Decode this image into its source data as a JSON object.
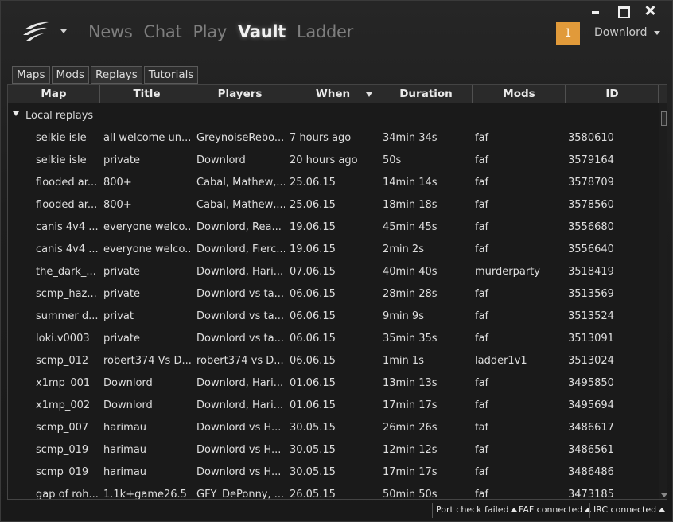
{
  "nav": {
    "items": [
      {
        "label": "News",
        "active": false
      },
      {
        "label": "Chat",
        "active": false
      },
      {
        "label": "Play",
        "active": false
      },
      {
        "label": "Vault",
        "active": true
      },
      {
        "label": "Ladder",
        "active": false
      }
    ]
  },
  "user": {
    "notification_count": "1",
    "name": "Downlord"
  },
  "tabs": [
    "Maps",
    "Mods",
    "Replays",
    "Tutorials"
  ],
  "table": {
    "columns": [
      "Map",
      "Title",
      "Players",
      "When",
      "Duration",
      "Mods",
      "ID"
    ],
    "sorted_column": "When",
    "group_label": "Local replays",
    "rows": [
      [
        "selkie isle",
        "all welcome un...",
        "GreynoiseRebo...",
        "7 hours ago",
        "34min 34s",
        "faf",
        "3580610"
      ],
      [
        "selkie isle",
        "private",
        "Downlord",
        "20 hours ago",
        "50s",
        "faf",
        "3579164"
      ],
      [
        "flooded ar...",
        "800+",
        "Cabal, Mathew,...",
        "25.06.15",
        "14min 14s",
        "faf",
        "3578709"
      ],
      [
        "flooded ar...",
        "800+",
        "Cabal, Mathew,...",
        "25.06.15",
        "18min 18s",
        "faf",
        "3578560"
      ],
      [
        "canis 4v4 ...",
        "everyone welco...",
        "Downlord, Rea...",
        "19.06.15",
        "45min 45s",
        "faf",
        "3556680"
      ],
      [
        "canis 4v4 ...",
        "everyone welco...",
        "Downlord, Fierc...",
        "19.06.15",
        "2min 2s",
        "faf",
        "3556640"
      ],
      [
        "the_dark_...",
        "private",
        "Downlord, Hari...",
        "07.06.15",
        "40min 40s",
        "murderparty",
        "3518419"
      ],
      [
        "scmp_haz...",
        "private",
        "Downlord vs ta...",
        "06.06.15",
        "28min 28s",
        "faf",
        "3513569"
      ],
      [
        "summer d...",
        "privat",
        "Downlord vs ta...",
        "06.06.15",
        "9min 9s",
        "faf",
        "3513524"
      ],
      [
        "loki.v0003",
        "private",
        "Downlord vs ta...",
        "06.06.15",
        "35min 35s",
        "faf",
        "3513091"
      ],
      [
        "scmp_012",
        "robert374 Vs D...",
        "robert374 vs D...",
        "06.06.15",
        "1min 1s",
        "ladder1v1",
        "3513024"
      ],
      [
        "x1mp_001",
        "Downlord",
        "Downlord, Hari...",
        "01.06.15",
        "13min 13s",
        "faf",
        "3495850"
      ],
      [
        "x1mp_002",
        "Downlord",
        "Downlord, Hari...",
        "01.06.15",
        "17min 17s",
        "faf",
        "3495694"
      ],
      [
        "scmp_007",
        "harimau",
        "Downlord vs H...",
        "30.05.15",
        "26min 26s",
        "faf",
        "3486617"
      ],
      [
        "scmp_019",
        "harimau",
        "Downlord vs H...",
        "30.05.15",
        "12min 12s",
        "faf",
        "3486561"
      ],
      [
        "scmp_019",
        "harimau",
        "Downlord vs H...",
        "30.05.15",
        "17min 17s",
        "faf",
        "3486486"
      ],
      [
        "gap of roh...",
        "1.1k+game26.5",
        "GFY_DePonny, ...",
        "26.05.15",
        "50min 50s",
        "faf",
        "3473185"
      ]
    ]
  },
  "status": {
    "port_check": "Port check failed",
    "faf": "FAF connected",
    "irc": "IRC connected"
  },
  "colors": {
    "accent": "#e19a3a",
    "background": "#1b1b1b"
  }
}
